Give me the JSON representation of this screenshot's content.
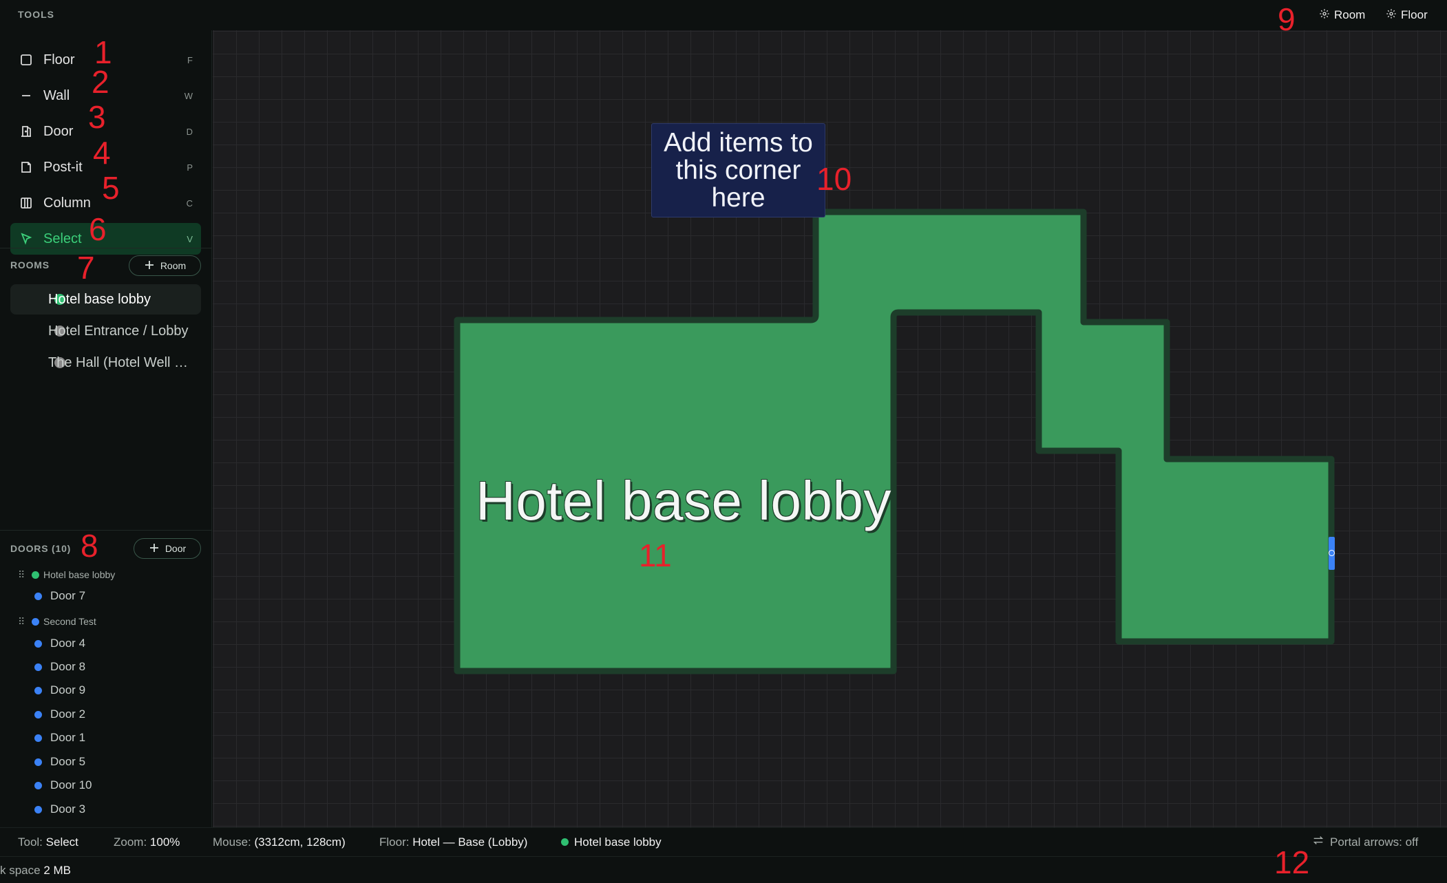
{
  "top": {
    "tools_title": "TOOLS",
    "room_btn": "Room",
    "floor_btn": "Floor"
  },
  "tools": [
    {
      "label": "Floor",
      "key": "F",
      "icon": "square-icon"
    },
    {
      "label": "Wall",
      "key": "W",
      "icon": "dash-icon"
    },
    {
      "label": "Door",
      "key": "D",
      "icon": "door-icon"
    },
    {
      "label": "Post-it",
      "key": "P",
      "icon": "note-icon"
    },
    {
      "label": "Column",
      "key": "C",
      "icon": "columns-icon"
    },
    {
      "label": "Select",
      "key": "V",
      "icon": "pointer-icon",
      "active": true
    }
  ],
  "rooms": {
    "title": "ROOMS",
    "add_label": "Room",
    "items": [
      {
        "label": "Hotel base lobby",
        "color": "#2fbf71",
        "active": true
      },
      {
        "label": "Hotel Entrance / Lobby",
        "color": "#8a8a8a"
      },
      {
        "label": "The Hall (Hotel Well Room)",
        "color": "#8a8a8a"
      }
    ]
  },
  "doors": {
    "title": "DOORS (10)",
    "add_label": "Door",
    "groups": [
      {
        "label": "Hotel base lobby",
        "color": "#2fbf71",
        "doors": [
          "Door 7"
        ]
      },
      {
        "label": "Second Test",
        "color": "#3b82f6",
        "doors": [
          "Door 4",
          "Door 8",
          "Door 9",
          "Door 2",
          "Door 1",
          "Door 5",
          "Door 10",
          "Door 3"
        ]
      }
    ]
  },
  "canvas": {
    "postit_text": "Add items to this corner here",
    "room_label": "Hotel base lobby",
    "room_fill": "#3a9a5c",
    "room_border": "#1d3d2a"
  },
  "status": {
    "tool_label": "Tool:",
    "tool_value": "Select",
    "zoom_label": "Zoom:",
    "zoom_value": "100%",
    "mouse_label": "Mouse:",
    "mouse_value": "(3312cm, 128cm)",
    "floor_label": "Floor:",
    "floor_value": "Hotel — Base (Lobby)",
    "room_value": "Hotel base lobby",
    "portal_label": "Portal arrows: off"
  },
  "bottom": {
    "space_label": "k space",
    "space_value": "2 MB"
  },
  "annotations": [
    "1",
    "2",
    "3",
    "4",
    "5",
    "6",
    "7",
    "8",
    "9",
    "10",
    "11",
    "12"
  ]
}
